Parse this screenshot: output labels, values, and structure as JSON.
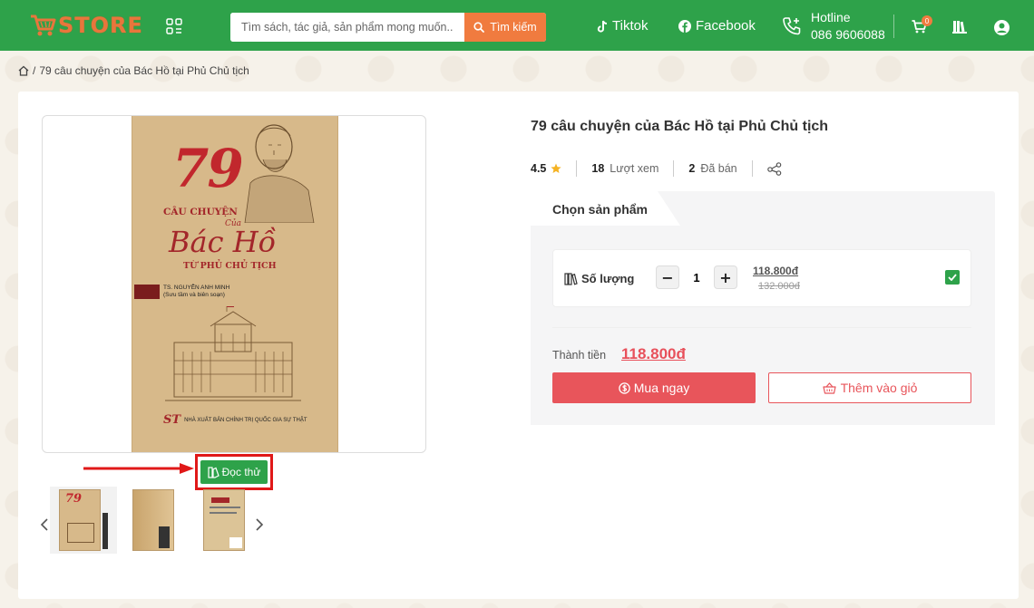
{
  "header": {
    "logo_text": "STORE",
    "search_placeholder": "Tìm sách, tác giả, sản phẩm mong muốn...",
    "search_button": "Tìm kiếm",
    "tiktok": "Tiktok",
    "facebook": "Facebook",
    "hotline_label": "Hotline",
    "hotline_number": "086 9606088",
    "cart_count": "0",
    "brand_color": "#2ea24a",
    "accent_color": "#f07b3f"
  },
  "breadcrumb": {
    "separator": "/",
    "current": "79 câu chuyện của Bác Hồ tại Phủ Chủ tịch"
  },
  "gallery": {
    "cover": {
      "number": "79",
      "line1": "CÂU CHUYỆN",
      "line2": "Của",
      "line3": "Bác Hồ",
      "line4": "TỪ PHỦ CHỦ TỊCH",
      "author": "TS. NGUYỄN ANH MINH",
      "author_note": "(Sưu tầm và biên soạn)",
      "publisher_mark": "ST",
      "publisher": "NHÀ XUẤT BẢN CHÍNH TRỊ QUỐC GIA SỰ THẬT"
    },
    "read_try_label": "Đọc thử",
    "thumbnails": [
      "thumb-front-cover",
      "thumb-side-view",
      "thumb-back-cover"
    ]
  },
  "product": {
    "title": "79 câu chuyện của Bác Hồ tại Phủ Chủ tịch",
    "rating": "4.5",
    "views_count": "18",
    "views_label": "Lượt xem",
    "sold_count": "2",
    "sold_label": "Đã bán",
    "select_tab": "Chọn sản phẩm",
    "quantity_label": "Số lượng",
    "quantity_value": "1",
    "price": "118.800đ",
    "old_price": "132.000đ",
    "total_label": "Thành tiền",
    "total_value": "118.800đ",
    "buy_now": "Mua ngay",
    "add_to_cart": "Thêm vào giỏ",
    "price_color": "#e8505b"
  }
}
